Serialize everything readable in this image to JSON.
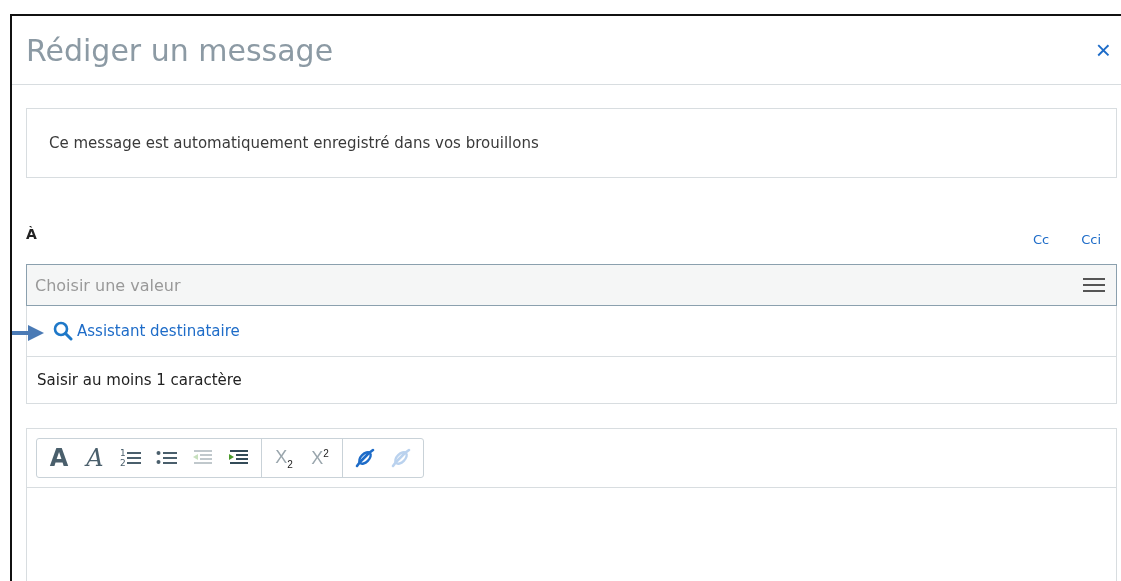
{
  "dialog": {
    "title": "Rédiger un message",
    "close": "×"
  },
  "notice": "Ce message est automatiquement enregistré dans vos brouillons",
  "recipients": {
    "label": "À",
    "links": [
      "Cc",
      "Cci"
    ],
    "field": {
      "placeholder": "Choisir une valeur"
    },
    "dropdown": [
      {
        "kind": "assistant",
        "text": "Assistant destinataire"
      },
      {
        "kind": "hint",
        "text": "Saisir au moins 1 caractère"
      }
    ]
  },
  "toolbar": [
    [
      {
        "kind": "bold",
        "glyph": "A",
        "disabled": false
      },
      {
        "kind": "italic",
        "glyph": "A",
        "disabled": false
      },
      {
        "kind": "ordered-list",
        "numbers": [
          "1",
          "2"
        ],
        "disabled": false
      },
      {
        "kind": "bullet-list",
        "disabled": false
      },
      {
        "kind": "outdent",
        "disabled": true
      },
      {
        "kind": "indent",
        "disabled": false
      }
    ],
    [
      {
        "kind": "subscript",
        "glyph": "X$_{2}$",
        "disabled": true
      },
      {
        "kind": "superscript",
        "glyph": "X$^{2}$",
        "disabled": true
      }
    ],
    [
      {
        "kind": "link",
        "disabled": false
      },
      {
        "kind": "unlink",
        "disabled": true
      }
    ]
  ]
}
